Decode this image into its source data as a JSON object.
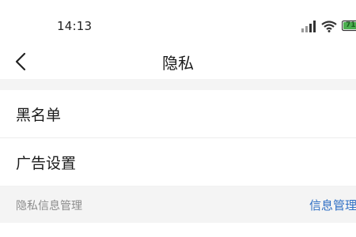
{
  "status_bar": {
    "time": "14:13",
    "battery_level": "71",
    "battery_color": "#4caf50",
    "icons": [
      "signal-icon",
      "wifi-icon",
      "battery-icon"
    ]
  },
  "nav": {
    "back_icon": "chevron-left-icon",
    "title": "隐私"
  },
  "items": [
    {
      "label": "黑名单"
    },
    {
      "label": "广告设置"
    }
  ],
  "section": {
    "title": "隐私信息管理",
    "link": "信息管理",
    "link_color": "#2f6fc4"
  }
}
